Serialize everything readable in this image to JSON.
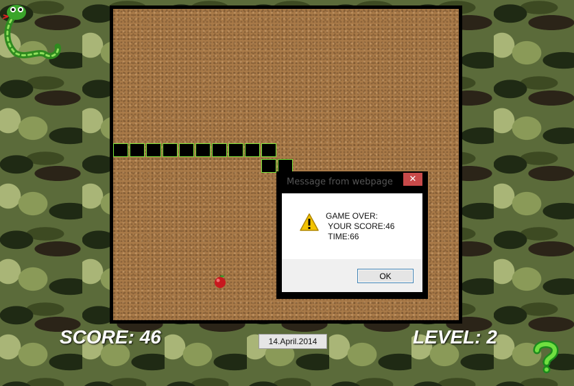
{
  "hud": {
    "score_label": "SCORE:",
    "score_value": "46",
    "level_label": "LEVEL:",
    "level_value": "2",
    "date": "14.April.2014"
  },
  "dialog": {
    "title": "Message from webpage",
    "close_glyph": "✕",
    "line1": "GAME OVER:",
    "line2": " YOUR SCORE:46",
    "line3": " TIME:66",
    "ok_label": "OK",
    "icon": "warning-icon"
  },
  "icons": {
    "logo": "snake-logo",
    "help": "help-question-icon",
    "food": "apple-icon"
  },
  "colors": {
    "snake_fill": "#000000",
    "snake_outline": "#7ce83a",
    "board": "#a97a48",
    "close_button": "#c84a4a"
  }
}
